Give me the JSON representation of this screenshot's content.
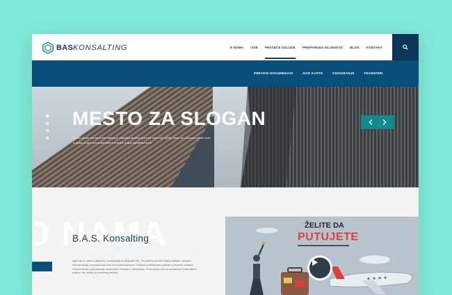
{
  "brand": {
    "part1": "BAS",
    "part2": "KONSALTING"
  },
  "nav": {
    "items": [
      {
        "label": "O NAMA",
        "active": false
      },
      {
        "label": "VIZE",
        "active": false
      },
      {
        "label": "PRATEĆE USLUGE",
        "active": true
      },
      {
        "label": "PREPORUKE KLIJENATA",
        "active": false
      },
      {
        "label": "BLOG",
        "active": false
      },
      {
        "label": "KONTAKT",
        "active": false
      }
    ],
    "search_icon": "search-icon"
  },
  "submenu": {
    "items": [
      "PREVODI DOKUMENATA",
      "AVIO KARTE",
      "OSIGURANJE",
      "TRANSFERI"
    ]
  },
  "hero": {
    "title": "MESTO ZA SLOGAN",
    "text": "Lorem Ipsum has been the industry's standard dummy text ever since the 1500s, when an unknown printer took a galley of type and scrambled it to make a type specimen book.",
    "slide_count": 4,
    "active_slide": 1
  },
  "about": {
    "watermark": "O NAMA",
    "title": "B.A.S. Konsalting",
    "text": "Agencija se nalazi u priprema i konsultacija za dobijanje vize. Tim koji kroz proces Vašeg zahteva i obaveze, dokumentacija, usmerava Vas kroz sve korake pripreme. Pružamo profesionalnu podršku u pripremi potrebne dokumentacije, popunjavanju neophodnih formulara i zakazivanju. Povezujemo Vas sa relevantnim institucijama i pratimo Vaš zahtev do konačnog rešenja."
  },
  "media": {
    "line1": "ŽELITE DA",
    "line2": "PUTUJETE",
    "play_icon": "play-icon"
  },
  "colors": {
    "background": "#7fe8d6",
    "navy": "#0e3a5c",
    "submenu": "#074e7a",
    "teal": "#128a8a",
    "accent_red": "#d9423a"
  }
}
